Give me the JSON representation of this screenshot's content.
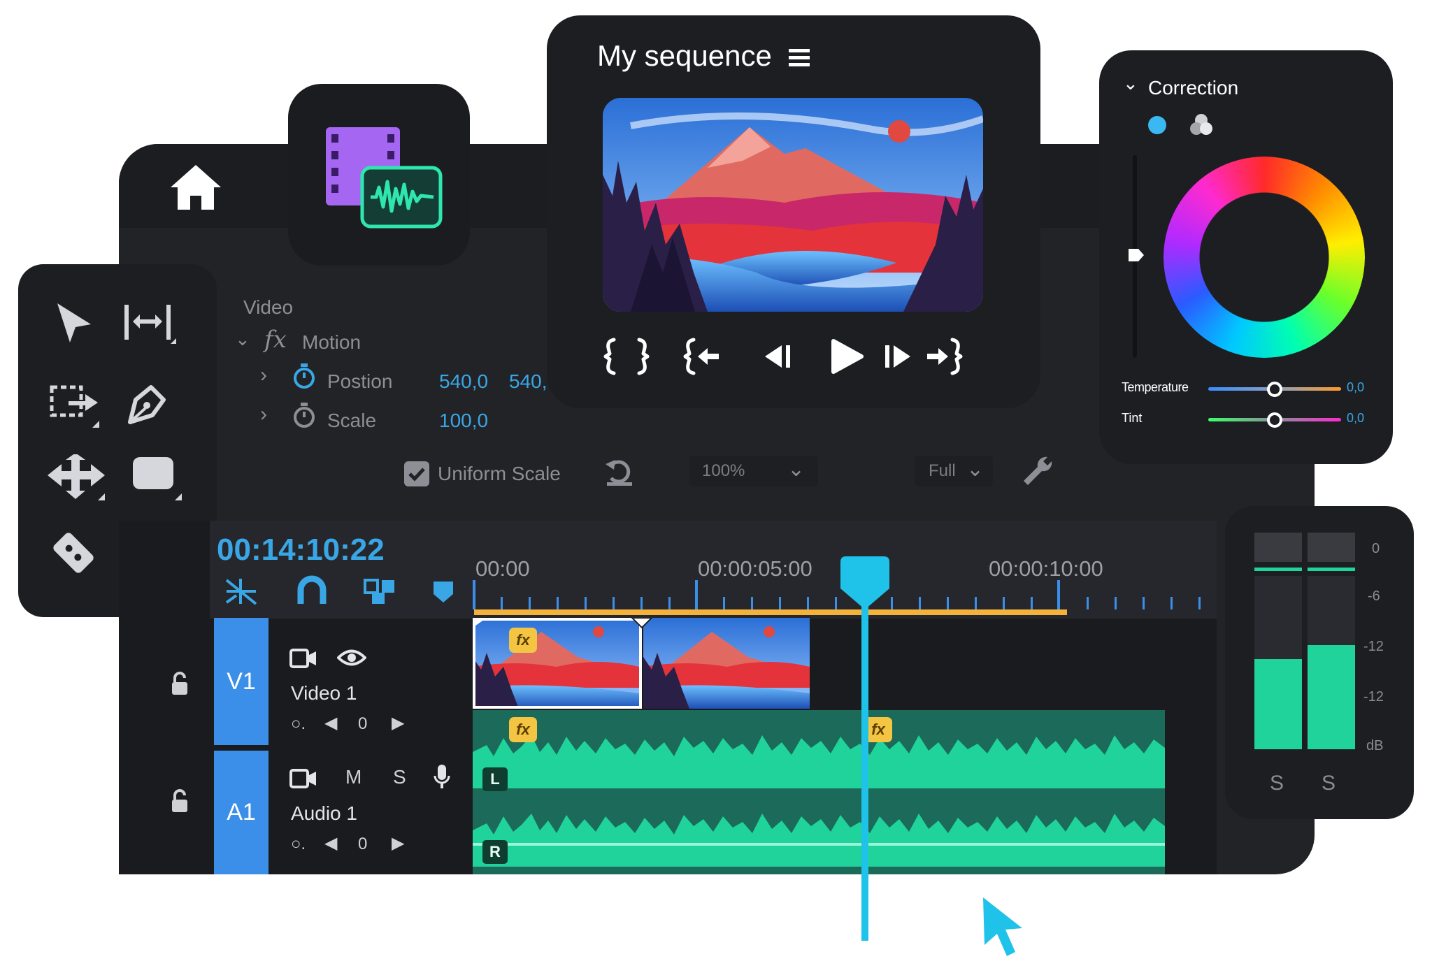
{
  "monitor": {
    "title": "My sequence",
    "menu_icon": "hamburger-menu-icon",
    "transport_icons": [
      "mark-in-icon",
      "mark-out-icon",
      "go-to-in-icon",
      "step-back-icon",
      "play-icon",
      "step-forward-icon",
      "go-to-out-icon"
    ]
  },
  "effect_controls": {
    "section": "Video",
    "effect": "Motion",
    "fx_glyph": "fx",
    "position_label": "Postion",
    "position_x": "540,0",
    "position_y": "540,",
    "scale_label": "Scale",
    "scale_value": "100,0",
    "uniform_scale_label": "Uniform Scale",
    "uniform_scale_checked": true,
    "zoom_value": "100%",
    "resolution_value": "Full"
  },
  "correction": {
    "title": "Correction",
    "temperature_label": "Temperature",
    "temperature_value": "0,0",
    "tint_label": "Tint",
    "tint_value": "0,0"
  },
  "timeline": {
    "timecode": "00:14:10:22",
    "ruler_labels": [
      "00:00",
      "00:00:05:00",
      "00:00:10:00"
    ],
    "video_track": {
      "label": "V1",
      "name": "Video 1",
      "keyframe_value": "0"
    },
    "audio_track": {
      "label": "A1",
      "name": "Audio 1",
      "mute": "M",
      "solo": "S",
      "keyframe_value": "0",
      "left_channel": "L",
      "right_channel": "R"
    },
    "fx_badge": "fx"
  },
  "meters": {
    "scale_labels": [
      "0",
      "-6",
      "-12",
      "-12",
      "dB"
    ],
    "solo_labels": [
      "S",
      "S"
    ],
    "levels": [
      0.52,
      0.6
    ]
  },
  "colors": {
    "accent": "#1fc2e8",
    "track_blue": "#3b8fe8",
    "audio_green": "#1fd39b",
    "fx_yellow": "#f4c542"
  }
}
